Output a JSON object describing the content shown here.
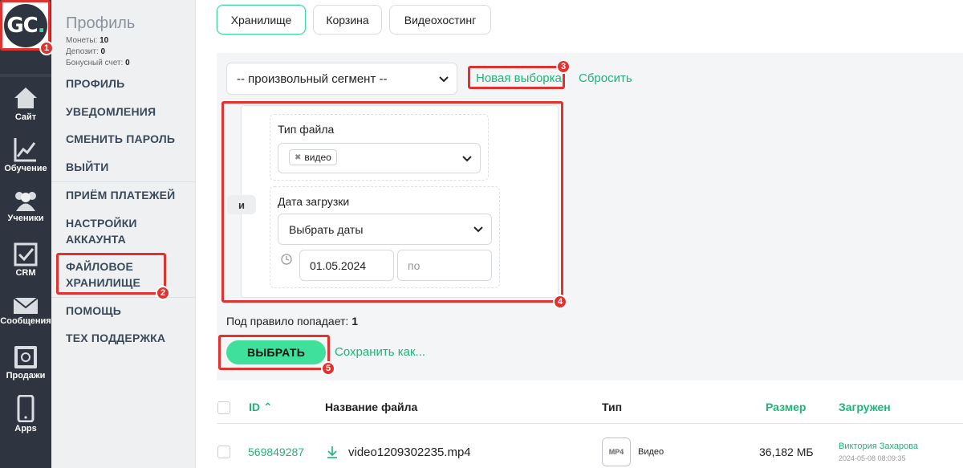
{
  "logo": {
    "text": "GC",
    "dot": "."
  },
  "rail": [
    {
      "label": "Сайт",
      "icon": "house-icon"
    },
    {
      "label": "Обучение",
      "icon": "chart-icon"
    },
    {
      "label": "Ученики",
      "icon": "users-icon"
    },
    {
      "label": "CRM",
      "icon": "checkbox-icon"
    },
    {
      "label": "Сообщения",
      "icon": "envelope-icon"
    },
    {
      "label": "Продажи",
      "icon": "safe-icon"
    },
    {
      "label": "Apps",
      "icon": "phone-icon"
    }
  ],
  "sidebar": {
    "title": "Профиль",
    "coins_label": "Монеты:",
    "coins": "10",
    "deposit_label": "Депозит:",
    "deposit": "0",
    "bonus_label": "Бонусный счет:",
    "bonus": "0",
    "items": [
      "ПРОФИЛЬ",
      "УВЕДОМЛЕНИЯ",
      "СМЕНИТЬ ПАРОЛЬ",
      "ВЫЙТИ",
      "ПРИЁМ ПЛАТЕЖЕЙ",
      "НАСТРОЙКИ АККАУНТА",
      "ФАЙЛОВОЕ ХРАНИЛИЩЕ",
      "ПОМОЩЬ",
      "ТЕХ ПОДДЕРЖКА"
    ]
  },
  "tabs": [
    "Хранилище",
    "Корзина",
    "Видеохостинг"
  ],
  "filter": {
    "segment": "-- произвольный сегмент --",
    "new_selection": "Новая выборка",
    "reset": "Сбросить",
    "and_label": "и",
    "file_type_label": "Тип файла",
    "file_type_chip": "видео",
    "upload_date_label": "Дата загрузки",
    "date_mode": "Выбрать даты",
    "date_from": "01.05.2024",
    "date_to_placeholder": "по",
    "hits_label": "Под правило попадает:",
    "hits_value": "1",
    "select_button": "ВЫБРАТЬ",
    "save_as": "Сохранить как..."
  },
  "table": {
    "headers": {
      "id": "ID",
      "name": "Название файла",
      "type": "Тип",
      "size": "Размер",
      "uploaded": "Загружен"
    },
    "rows": [
      {
        "id": "569849287",
        "name": "video1209302235.mp4",
        "type_badge": "MP4",
        "type": "Видео",
        "size": "36,182 МБ",
        "uploader": "Виктория Захарова",
        "date": "2024-05-08 08:09:35"
      }
    ]
  },
  "annotations": [
    "1",
    "2",
    "3",
    "4",
    "5"
  ],
  "colors": {
    "accent": "#3fe09c",
    "link": "#1fb37a",
    "rail": "#2e3540",
    "highlight": "#e0332f"
  }
}
